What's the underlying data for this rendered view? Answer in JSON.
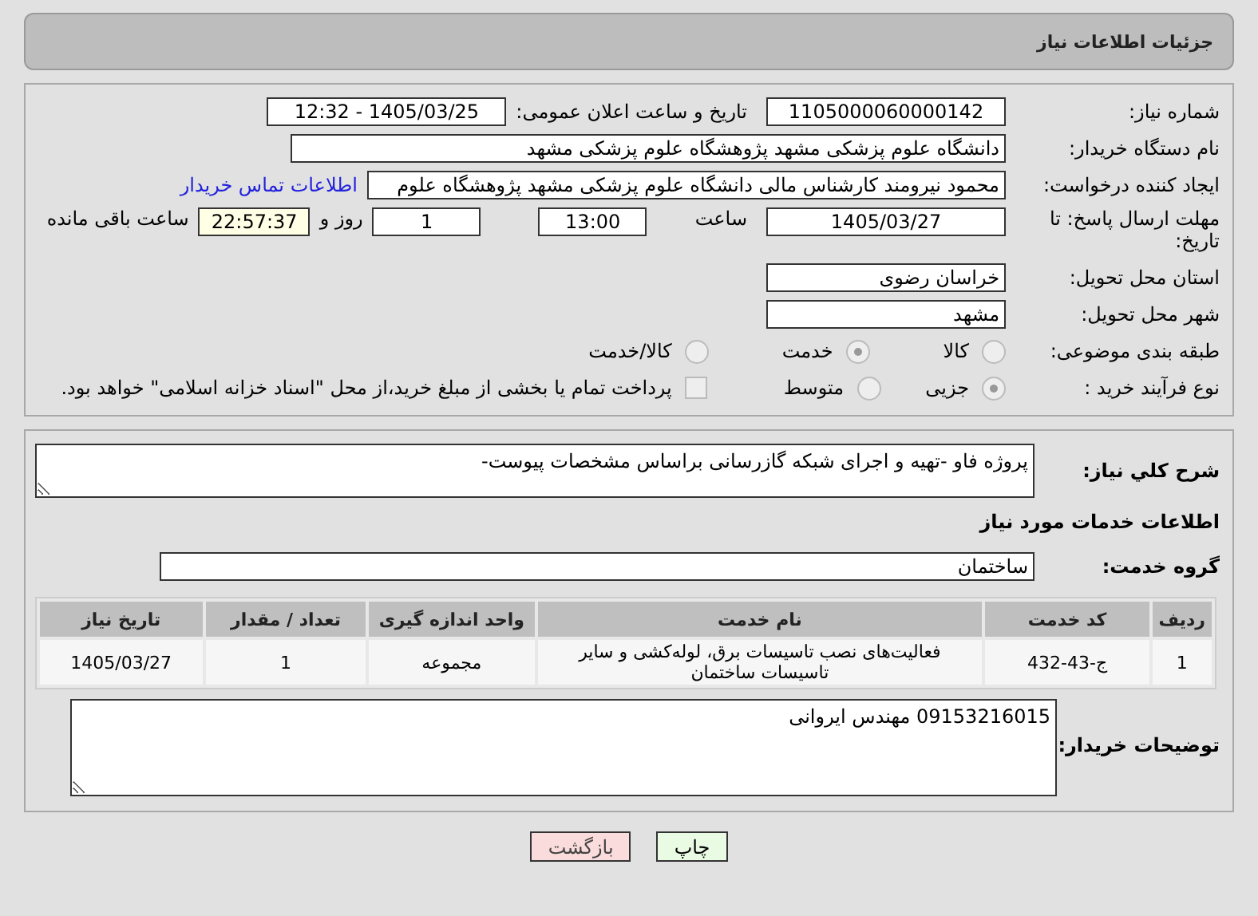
{
  "page_title": "جزئیات اطلاعات نیاز",
  "need_number": {
    "label": "شماره نیاز:",
    "value": "1105000060000142"
  },
  "announce": {
    "label": "تاریخ و ساعت اعلان عمومی:",
    "value": "1405/03/25 - 12:32"
  },
  "buyer_org": {
    "label": "نام دستگاه خریدار:",
    "value": "دانشگاه علوم پزشکی مشهد   پژوهشگاه علوم پزشکی مشهد"
  },
  "requester": {
    "label": "ایجاد کننده درخواست:",
    "value": "محمود نیرومند کارشناس مالی دانشگاه علوم پزشکی مشهد   پژوهشگاه علوم",
    "link": "اطلاعات تماس خریدار"
  },
  "deadline": {
    "label": "مهلت ارسال پاسخ: تا تاریخ:",
    "date": "1405/03/27",
    "time_label": "ساعت",
    "time": "13:00",
    "days": "1",
    "days_label": "روز و",
    "remaining": "22:57:37",
    "remaining_label": "ساعت باقی مانده"
  },
  "province": {
    "label": "استان محل تحویل:",
    "value": "خراسان رضوی"
  },
  "city": {
    "label": "شهر محل تحویل:",
    "value": "مشهد"
  },
  "category": {
    "label": "طبقه بندی موضوعی:",
    "options": [
      {
        "label": "کالا",
        "selected": false
      },
      {
        "label": "خدمت",
        "selected": true
      },
      {
        "label": "کالا/خدمت",
        "selected": false
      }
    ]
  },
  "process": {
    "label": "نوع فرآیند خرید :",
    "options": [
      {
        "label": "جزیی",
        "selected": true
      },
      {
        "label": "متوسط",
        "selected": false
      }
    ],
    "payment": {
      "label": "پرداخت تمام یا بخشی از مبلغ خرید،از محل \"اسناد خزانه اسلامی\" خواهد بود.",
      "checked": false
    }
  },
  "summary": {
    "label": "شرح کلي نياز:",
    "value": "پروژه فاو -تهیه و اجرای شبکه گازرسانی براساس مشخصات پیوست-"
  },
  "services_heading": "اطلاعات خدمات مورد نیاز",
  "service_group": {
    "label": "گروه خدمت:",
    "value": "ساختمان"
  },
  "table": {
    "columns": [
      "ردیف",
      "کد خدمت",
      "نام خدمت",
      "واحد اندازه گیری",
      "تعداد / مقدار",
      "تاریخ نیاز"
    ],
    "rows": [
      [
        "1",
        "ج-43-432",
        "فعالیت‌های نصب تاسیسات برق، لوله‌کشی و سایر تاسیسات ساختمان",
        "مجموعه",
        "1",
        "1405/03/27"
      ]
    ]
  },
  "buyer_notes": {
    "label": "توضیحات خریدار:",
    "value": "09153216015 مهندس ایروانی"
  },
  "buttons": [
    {
      "label": "چاپ",
      "kind": "print"
    },
    {
      "label": "بازگشت",
      "kind": "back"
    }
  ]
}
